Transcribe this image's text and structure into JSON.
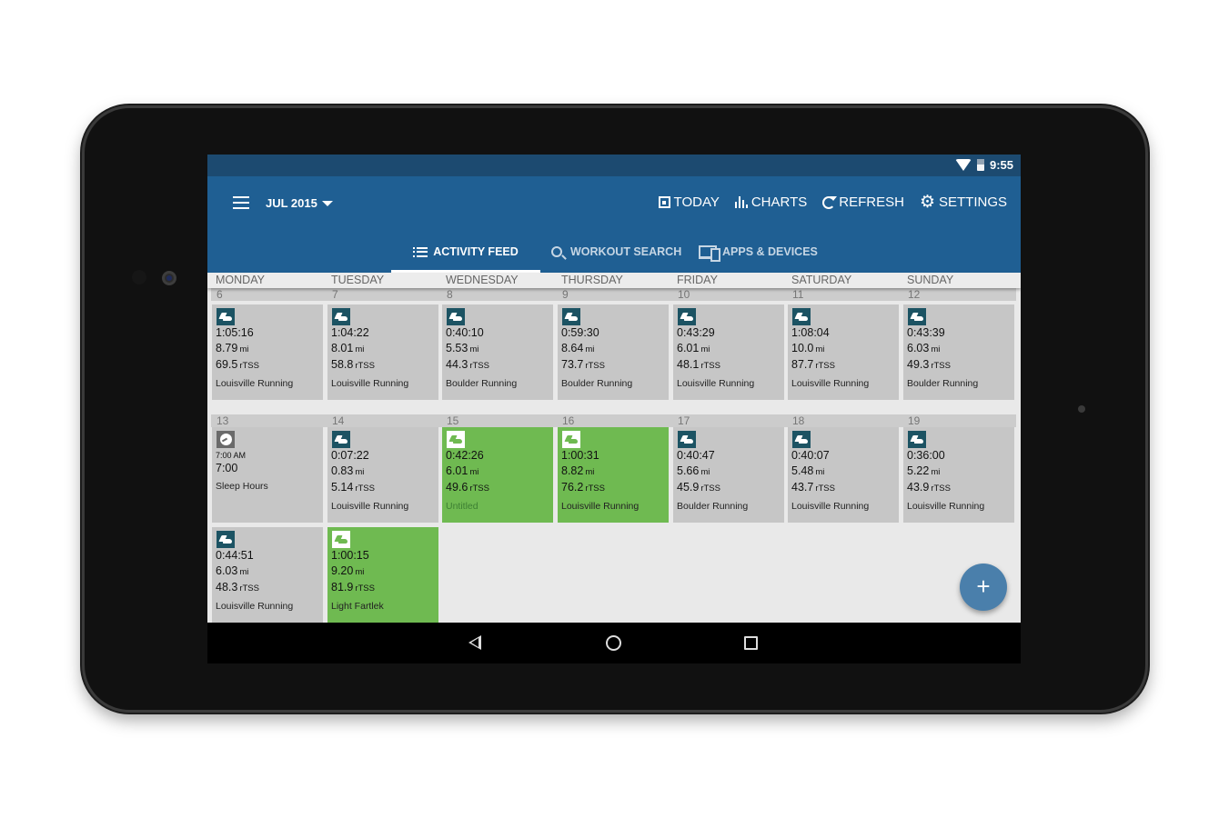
{
  "status_bar": {
    "time": "9:55",
    "wifi_icon": "wifi-icon",
    "battery_icon": "battery-icon"
  },
  "app_bar": {
    "menu_icon": "hamburger-menu-icon",
    "month": "JUL 2015",
    "actions": [
      {
        "label": "TODAY",
        "icon": "today-icon"
      },
      {
        "label": "CHARTS",
        "icon": "bar-chart-icon"
      },
      {
        "label": "REFRESH",
        "icon": "refresh-icon"
      },
      {
        "label": "SETTINGS",
        "icon": "gear-icon"
      }
    ]
  },
  "tabs": [
    {
      "label": "ACTIVITY FEED",
      "icon": "list-icon",
      "active": true
    },
    {
      "label": "WORKOUT SEARCH",
      "icon": "search-icon",
      "active": false
    },
    {
      "label": "APPS & DEVICES",
      "icon": "devices-icon",
      "active": false
    }
  ],
  "weekdays": [
    "MONDAY",
    "TUESDAY",
    "WEDNESDAY",
    "THURSDAY",
    "FRIDAY",
    "SATURDAY",
    "SUNDAY"
  ],
  "weeks": [
    {
      "dates": [
        "6",
        "7",
        "8",
        "9",
        "10",
        "11",
        "12"
      ],
      "workouts": [
        {
          "day": 0,
          "duration": "1:05:16",
          "distance": "8.79",
          "dist_unit": "mi",
          "tss": "69.5",
          "tss_unit": "rTSS",
          "title": "Louisville Running",
          "completed": false
        },
        {
          "day": 1,
          "duration": "1:04:22",
          "distance": "8.01",
          "dist_unit": "mi",
          "tss": "58.8",
          "tss_unit": "rTSS",
          "title": "Louisville Running",
          "completed": false
        },
        {
          "day": 2,
          "duration": "0:40:10",
          "distance": "5.53",
          "dist_unit": "mi",
          "tss": "44.3",
          "tss_unit": "rTSS",
          "title": "Boulder Running",
          "completed": false
        },
        {
          "day": 3,
          "duration": "0:59:30",
          "distance": "8.64",
          "dist_unit": "mi",
          "tss": "73.7",
          "tss_unit": "rTSS",
          "title": "Boulder Running",
          "completed": false
        },
        {
          "day": 4,
          "duration": "0:43:29",
          "distance": "6.01",
          "dist_unit": "mi",
          "tss": "48.1",
          "tss_unit": "rTSS",
          "title": "Louisville Running",
          "completed": false
        },
        {
          "day": 5,
          "duration": "1:08:04",
          "distance": "10.0",
          "dist_unit": "mi",
          "tss": "87.7",
          "tss_unit": "rTSS",
          "title": "Louisville Running",
          "completed": false
        },
        {
          "day": 6,
          "duration": "0:43:39",
          "distance": "6.03",
          "dist_unit": "mi",
          "tss": "49.3",
          "tss_unit": "rTSS",
          "title": "Boulder Running",
          "completed": false
        }
      ]
    },
    {
      "dates": [
        "13",
        "14",
        "15",
        "16",
        "17",
        "18",
        "19"
      ],
      "sleep": {
        "day": 0,
        "time": "7:00 AM",
        "value": "7:00",
        "title": "Sleep Hours",
        "icon": "gauge-icon"
      },
      "workouts": [
        {
          "day": 1,
          "duration": "0:07:22",
          "distance": "0.83",
          "dist_unit": "mi",
          "tss": "5.14",
          "tss_unit": "rTSS",
          "title": "Louisville Running",
          "completed": false
        },
        {
          "day": 2,
          "duration": "0:42:26",
          "distance": "6.01",
          "dist_unit": "mi",
          "tss": "49.6",
          "tss_unit": "rTSS",
          "title": "Untitled",
          "completed": true
        },
        {
          "day": 3,
          "duration": "1:00:31",
          "distance": "8.82",
          "dist_unit": "mi",
          "tss": "76.2",
          "tss_unit": "rTSS",
          "title": "Louisville Running",
          "completed": true
        },
        {
          "day": 4,
          "duration": "0:40:47",
          "distance": "5.66",
          "dist_unit": "mi",
          "tss": "45.9",
          "tss_unit": "rTSS",
          "title": "Boulder Running",
          "completed": false
        },
        {
          "day": 5,
          "duration": "0:40:07",
          "distance": "5.48",
          "dist_unit": "mi",
          "tss": "43.7",
          "tss_unit": "rTSS",
          "title": "Louisville Running",
          "completed": false
        },
        {
          "day": 6,
          "duration": "0:36:00",
          "distance": "5.22",
          "dist_unit": "mi",
          "tss": "43.9",
          "tss_unit": "rTSS",
          "title": "Louisville Running",
          "completed": false
        }
      ],
      "extra_workouts": [
        {
          "day": 0,
          "duration": "0:44:51",
          "distance": "6.03",
          "dist_unit": "mi",
          "tss": "48.3",
          "tss_unit": "rTSS",
          "title": "Louisville Running",
          "completed": false
        },
        {
          "day": 1,
          "duration": "1:00:15",
          "distance": "9.20",
          "dist_unit": "mi",
          "tss": "81.9",
          "tss_unit": "rTSS",
          "title": "Light Fartlek",
          "completed": true
        }
      ]
    }
  ],
  "fab": {
    "label": "+",
    "icon": "add-icon"
  },
  "nav_bar": {
    "back_icon": "back-icon",
    "home_icon": "home-icon",
    "recents_icon": "recents-icon"
  },
  "colors": {
    "app_bar": "#1f5f93",
    "status_bar": "#1c4a70",
    "completed": "#6fba51",
    "planned": "#c6c6c6",
    "badge": "#1c5363",
    "fab": "#4a7fab"
  }
}
